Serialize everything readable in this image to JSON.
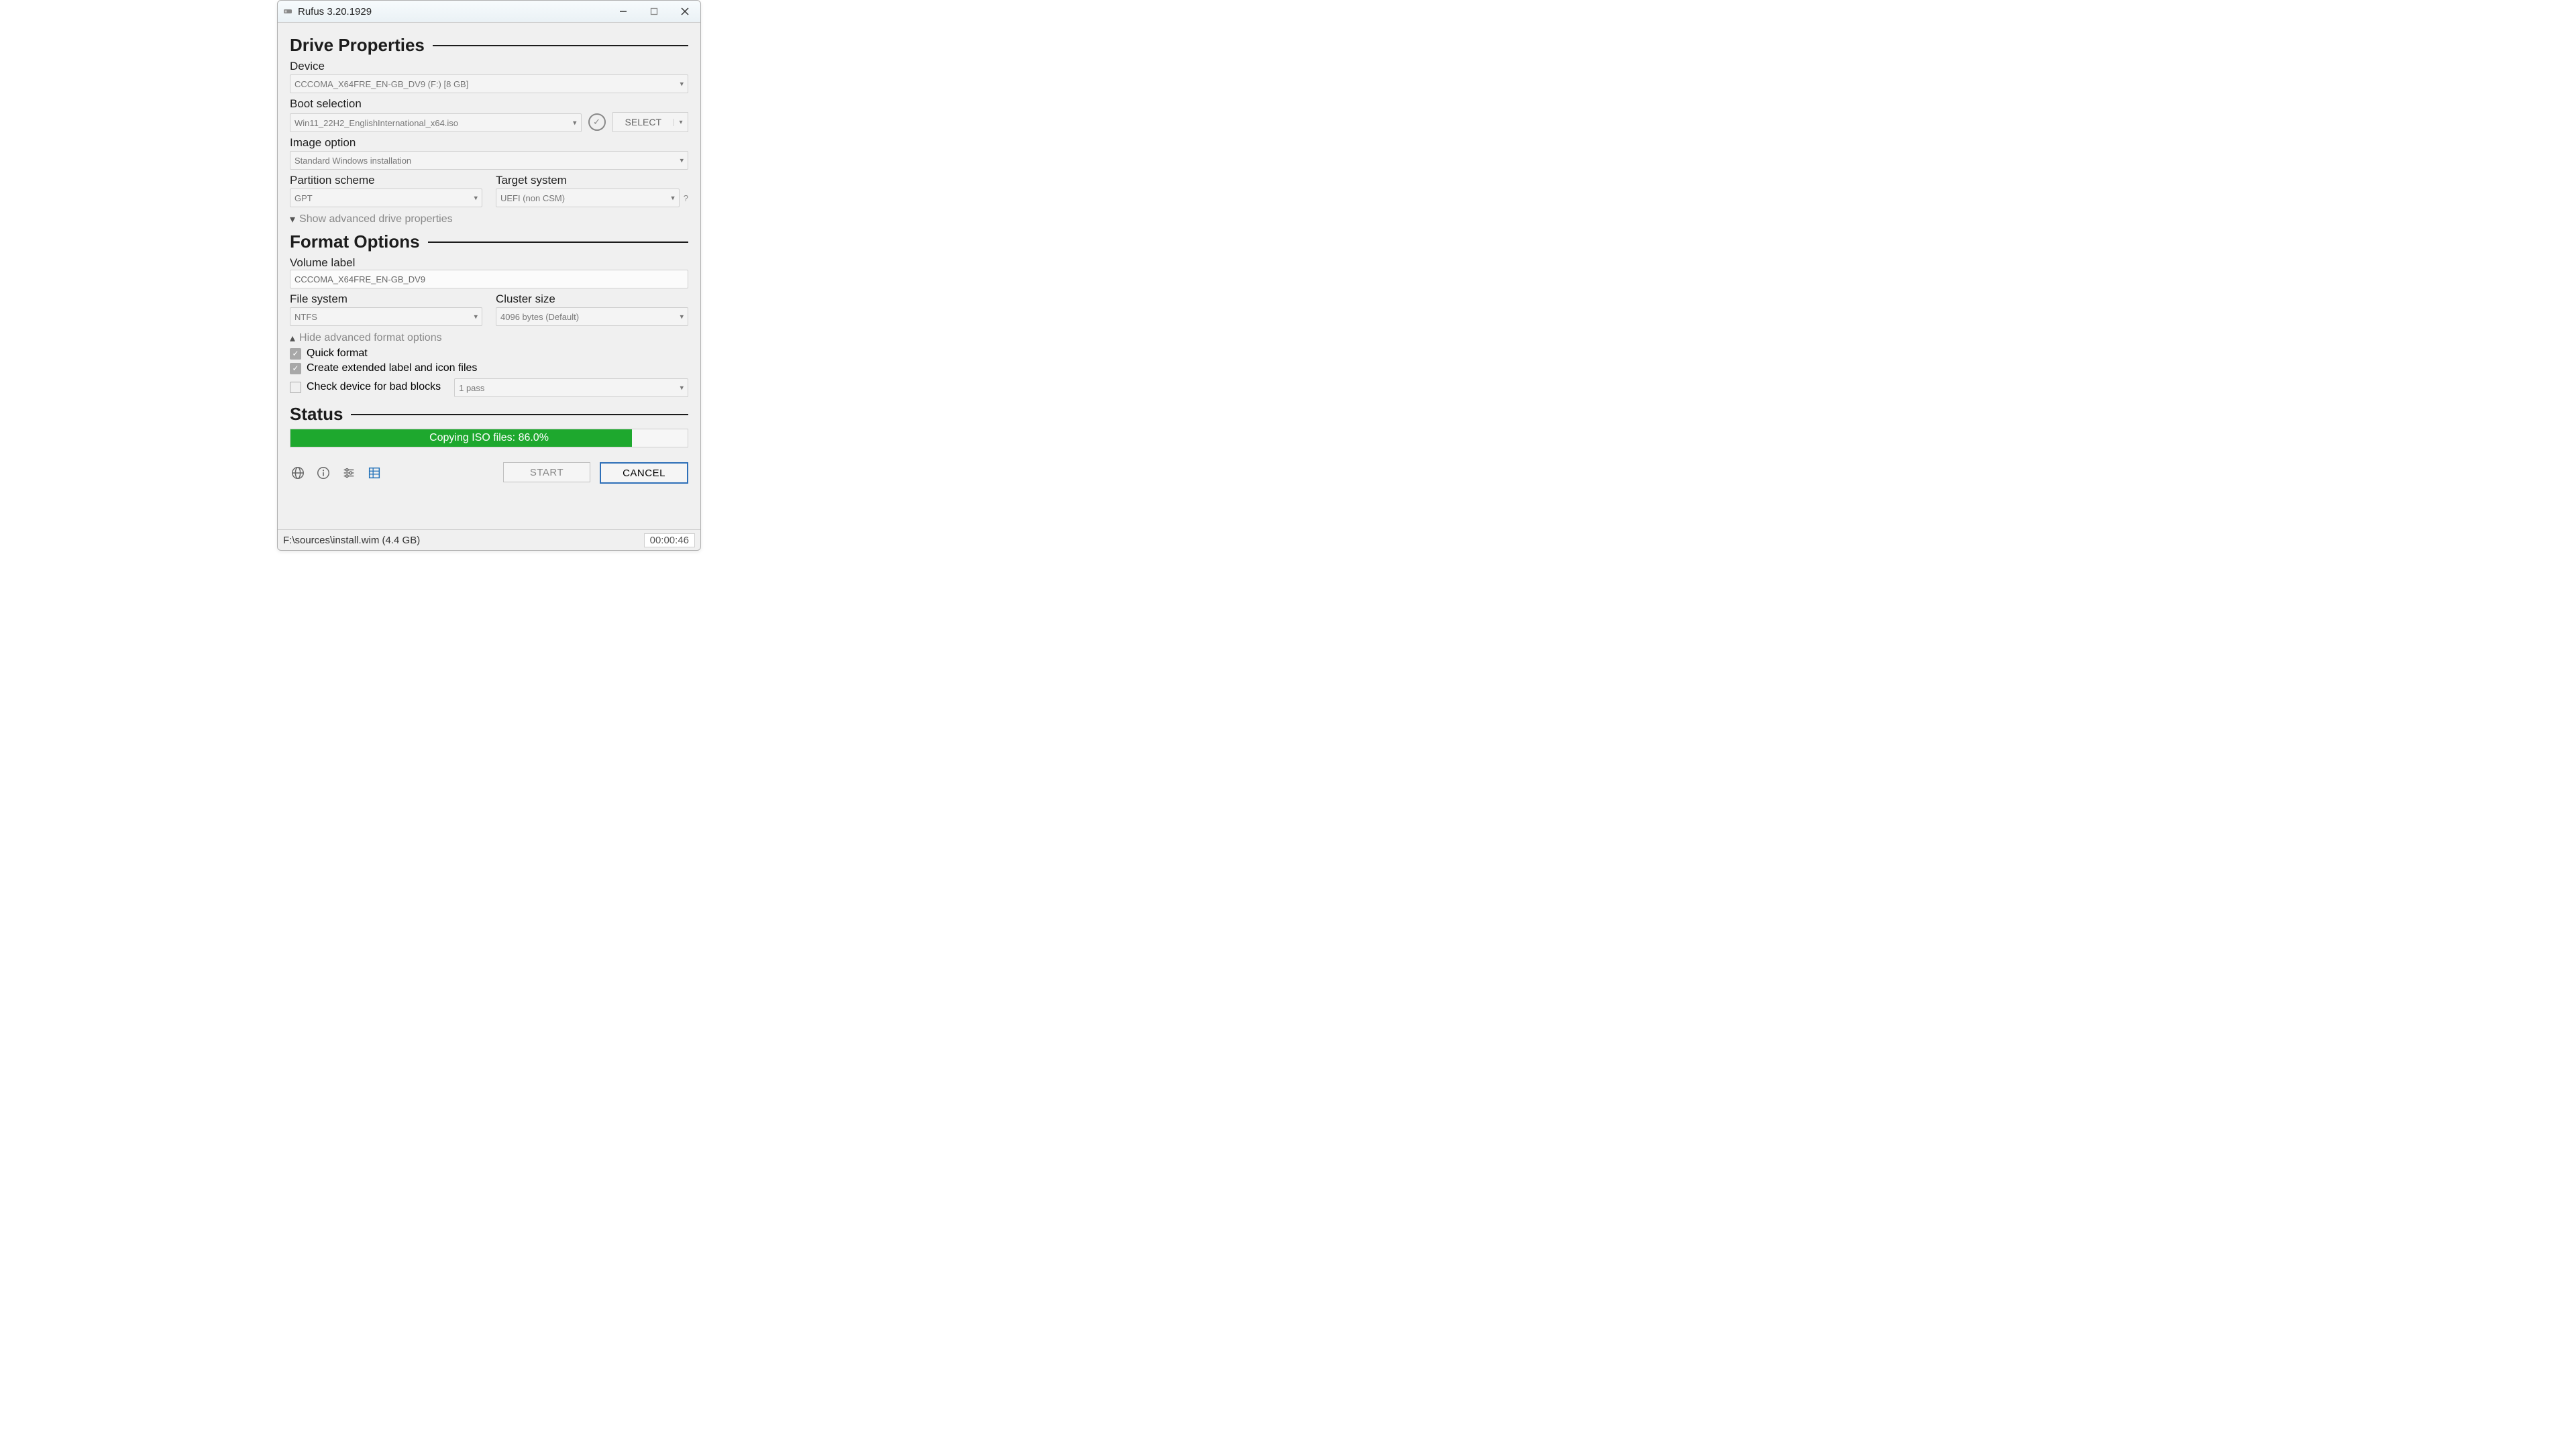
{
  "window": {
    "title": "Rufus 3.20.1929"
  },
  "sections": {
    "drive": "Drive Properties",
    "format": "Format Options",
    "status": "Status"
  },
  "labels": {
    "device": "Device",
    "boot_selection": "Boot selection",
    "image_option": "Image option",
    "partition_scheme": "Partition scheme",
    "target_system": "Target system",
    "show_advanced_drive": "Show advanced drive properties",
    "volume_label": "Volume label",
    "file_system": "File system",
    "cluster_size": "Cluster size",
    "hide_advanced_format": "Hide advanced format options",
    "quick_format": "Quick format",
    "extended_label": "Create extended label and icon files",
    "bad_blocks": "Check device for bad blocks",
    "help_q": "?"
  },
  "values": {
    "device": "CCCOMA_X64FRE_EN-GB_DV9 (F:) [8 GB]",
    "boot_selection": "Win11_22H2_EnglishInternational_x64.iso",
    "image_option": "Standard Windows installation",
    "partition_scheme": "GPT",
    "target_system": "UEFI (non CSM)",
    "volume_label": "CCCOMA_X64FRE_EN-GB_DV9",
    "file_system": "NTFS",
    "cluster_size": "4096 bytes (Default)",
    "bad_blocks_passes": "1 pass"
  },
  "buttons": {
    "select": "SELECT",
    "start": "START",
    "cancel": "CANCEL"
  },
  "progress": {
    "text": "Copying ISO files: 86.0%",
    "percent": 86.0
  },
  "statusbar": {
    "file": "F:\\sources\\install.wim (4.4 GB)",
    "elapsed": "00:00:46"
  },
  "checks": {
    "quick_format": true,
    "extended_label": true,
    "bad_blocks": false
  }
}
